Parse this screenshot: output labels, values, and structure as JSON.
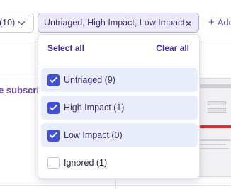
{
  "toolbar": {
    "prev_chip_label": "(10)",
    "active_filter_label": "Untriaged, High Impact, Low Impact",
    "clear_glyph": "×",
    "add_filter_label": "Add"
  },
  "background": {
    "partial_heading": "e subscri"
  },
  "dropdown": {
    "select_all_label": "Select all",
    "clear_all_label": "Clear all",
    "options": [
      {
        "label": "Untriaged (9)",
        "checked": true
      },
      {
        "label": "High Impact (1)",
        "checked": true
      },
      {
        "label": "Low Impact (0)",
        "checked": true
      },
      {
        "label": "Ignored (1)",
        "checked": false
      }
    ]
  },
  "colors": {
    "accent": "#3f51d8",
    "brand_text": "#3b2f7a",
    "selected_row_bg": "#e9ecfa",
    "active_chip_bg": "#ede9fb"
  },
  "icons": {
    "chevron": "chevron-down-icon",
    "close": "close-icon",
    "add": "plus-icon",
    "checkbox_on": "checkbox-checked-icon",
    "checkbox_off": "checkbox-empty-icon"
  }
}
